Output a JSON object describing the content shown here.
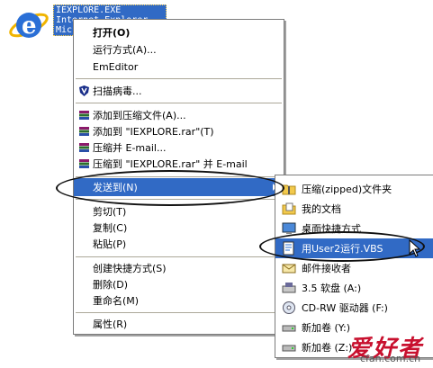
{
  "desktop_icon": {
    "name": "internet-explorer",
    "label_lines": [
      "IEXPLORE.EXE",
      "Internet Explorer",
      "Microsoft Corporation"
    ]
  },
  "context_menu": {
    "items": [
      {
        "label": "打开(O)",
        "bold": true
      },
      {
        "label": "运行方式(A)..."
      },
      {
        "label": "EmEditor"
      },
      {
        "label": "扫描病毒...",
        "icon": "antivirus-shield-icon"
      },
      {
        "label": "添加到压缩文件(A)...",
        "icon": "winrar-icon"
      },
      {
        "label": "添加到 \"IEXPLORE.rar\"(T)",
        "icon": "winrar-icon"
      },
      {
        "label": "压缩并 E-mail...",
        "icon": "winrar-icon"
      },
      {
        "label": "压缩到 \"IEXPLORE.rar\" 并 E-mail",
        "icon": "winrar-icon"
      },
      {
        "label": "发送到(N)",
        "highlighted": true,
        "submenu": true
      },
      {
        "label": "剪切(T)"
      },
      {
        "label": "复制(C)"
      },
      {
        "label": "粘贴(P)"
      },
      {
        "label": "创建快捷方式(S)"
      },
      {
        "label": "删除(D)"
      },
      {
        "label": "重命名(M)"
      },
      {
        "label": "属性(R)"
      }
    ]
  },
  "send_to_menu": {
    "items": [
      {
        "label": "压缩(zipped)文件夹",
        "icon": "zip-folder-icon"
      },
      {
        "label": "我的文档",
        "icon": "my-documents-icon"
      },
      {
        "label": "桌面快捷方式",
        "icon": "desktop-icon"
      },
      {
        "label": "用User2运行.VBS",
        "icon": "vbs-script-icon",
        "highlighted": true
      },
      {
        "label": "邮件接收者",
        "icon": "mail-recipient-icon"
      },
      {
        "label": "3.5 软盘 (A:)",
        "icon": "floppy-drive-icon"
      },
      {
        "label": "CD-RW 驱动器 (F:)",
        "icon": "cd-drive-icon"
      },
      {
        "label": "新加卷 (Y:)",
        "icon": "disk-drive-icon"
      },
      {
        "label": "新加卷 (Z:)",
        "icon": "disk-drive-icon"
      }
    ]
  },
  "watermark": {
    "text": "爱好者",
    "url": "cfan.com.cn",
    "color": "#c8102e"
  },
  "colors": {
    "highlight": "#316ac5",
    "menu_border": "#7b7b7b"
  }
}
